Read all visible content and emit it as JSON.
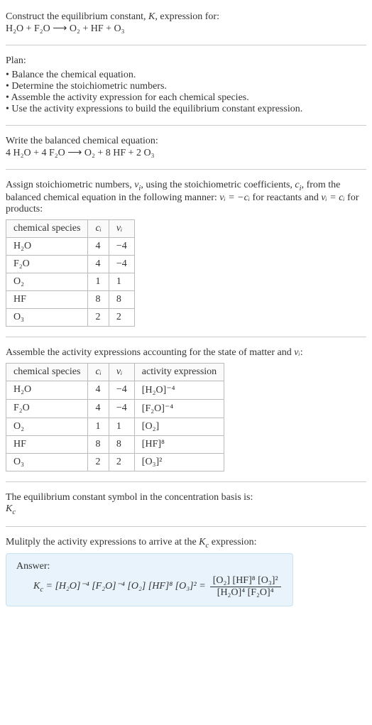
{
  "intro": {
    "line1": "Construct the equilibrium constant, ",
    "Ksym": "K",
    "line1b": ", expression for:",
    "unbalanced": "H₂O + F₂O ⟶ O₂ + HF + O₃"
  },
  "plan": {
    "title": "Plan:",
    "items": [
      "Balance the chemical equation.",
      "Determine the stoichiometric numbers.",
      "Assemble the activity expression for each chemical species.",
      "Use the activity expressions to build the equilibrium constant expression."
    ]
  },
  "balanced": {
    "title": "Write the balanced chemical equation:",
    "eq": "4 H₂O + 4 F₂O ⟶ O₂ + 8 HF + 2 O₃"
  },
  "stoich": {
    "intro_a": "Assign stoichiometric numbers, ",
    "nu": "ν",
    "sub_i": "i",
    "intro_b": ", using the stoichiometric coefficients, ",
    "c": "c",
    "intro_c": ", from the balanced chemical equation in the following manner: ",
    "rel_reactants": "νᵢ = −cᵢ",
    "intro_d": " for reactants and ",
    "rel_products": "νᵢ = cᵢ",
    "intro_e": " for products:",
    "headers": {
      "species": "chemical species",
      "ci": "cᵢ",
      "vi": "νᵢ"
    },
    "rows": [
      {
        "sp": "H₂O",
        "c": "4",
        "v": "−4"
      },
      {
        "sp": "F₂O",
        "c": "4",
        "v": "−4"
      },
      {
        "sp": "O₂",
        "c": "1",
        "v": "1"
      },
      {
        "sp": "HF",
        "c": "8",
        "v": "8"
      },
      {
        "sp": "O₃",
        "c": "2",
        "v": "2"
      }
    ]
  },
  "activity": {
    "intro_a": "Assemble the activity expressions accounting for the state of matter and ",
    "nu": "νᵢ",
    "intro_b": ":",
    "headers": {
      "species": "chemical species",
      "ci": "cᵢ",
      "vi": "νᵢ",
      "act": "activity expression"
    },
    "rows": [
      {
        "sp": "H₂O",
        "c": "4",
        "v": "−4",
        "a": "[H₂O]⁻⁴"
      },
      {
        "sp": "F₂O",
        "c": "4",
        "v": "−4",
        "a": "[F₂O]⁻⁴"
      },
      {
        "sp": "O₂",
        "c": "1",
        "v": "1",
        "a": "[O₂]"
      },
      {
        "sp": "HF",
        "c": "8",
        "v": "8",
        "a": "[HF]⁸"
      },
      {
        "sp": "O₃",
        "c": "2",
        "v": "2",
        "a": "[O₃]²"
      }
    ]
  },
  "kc_symbol": {
    "line": "The equilibrium constant symbol in the concentration basis is:",
    "sym": "K",
    "sub": "c"
  },
  "final": {
    "intro_a": "Mulitply the activity expressions to arrive at the ",
    "kc": "K",
    "kc_sub": "c",
    "intro_b": " expression:",
    "answer_label": "Answer:",
    "lhs": "Kc = [H₂O]⁻⁴ [F₂O]⁻⁴ [O₂] [HF]⁸ [O₃]² = ",
    "num": "[O₂] [HF]⁸ [O₃]²",
    "den": "[H₂O]⁴ [F₂O]⁴"
  }
}
